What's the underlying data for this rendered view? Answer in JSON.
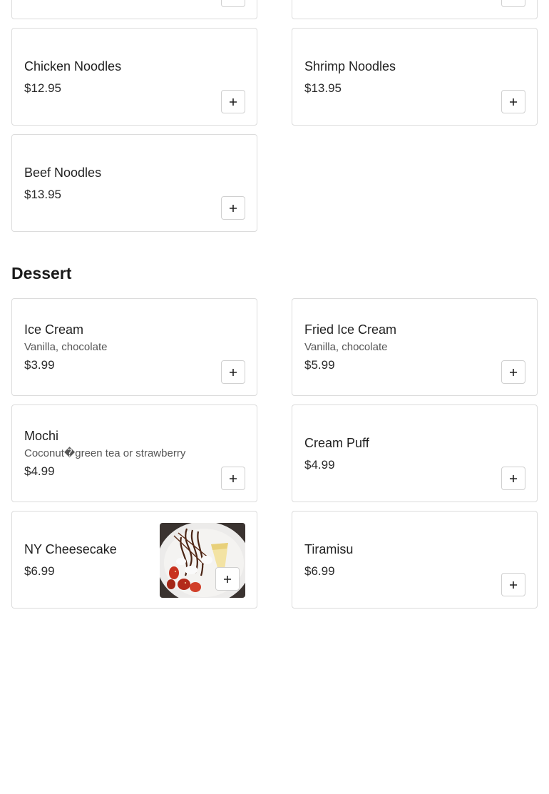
{
  "noodles": {
    "items": [
      {
        "name": "",
        "price": ""
      },
      {
        "name": "",
        "price": ""
      },
      {
        "name": "Chicken Noodles",
        "price": "$12.95"
      },
      {
        "name": "Shrimp Noodles",
        "price": "$13.95"
      },
      {
        "name": "Beef Noodles",
        "price": "$13.95"
      }
    ]
  },
  "dessert": {
    "title": "Dessert",
    "items": [
      {
        "name": "Ice Cream",
        "desc": "Vanilla, chocolate",
        "price": "$3.99"
      },
      {
        "name": "Fried Ice Cream",
        "desc": "Vanilla, chocolate",
        "price": "$5.99"
      },
      {
        "name": "Mochi",
        "desc": "Coconut�green tea or strawberry",
        "price": "$4.99"
      },
      {
        "name": "Cream Puff",
        "price": "$4.99"
      },
      {
        "name": "NY Cheesecake",
        "price": "$6.99",
        "image": "cheesecake-photo"
      },
      {
        "name": "Tiramisu",
        "price": "$6.99"
      }
    ]
  },
  "icons": {
    "add": "plus-icon"
  }
}
